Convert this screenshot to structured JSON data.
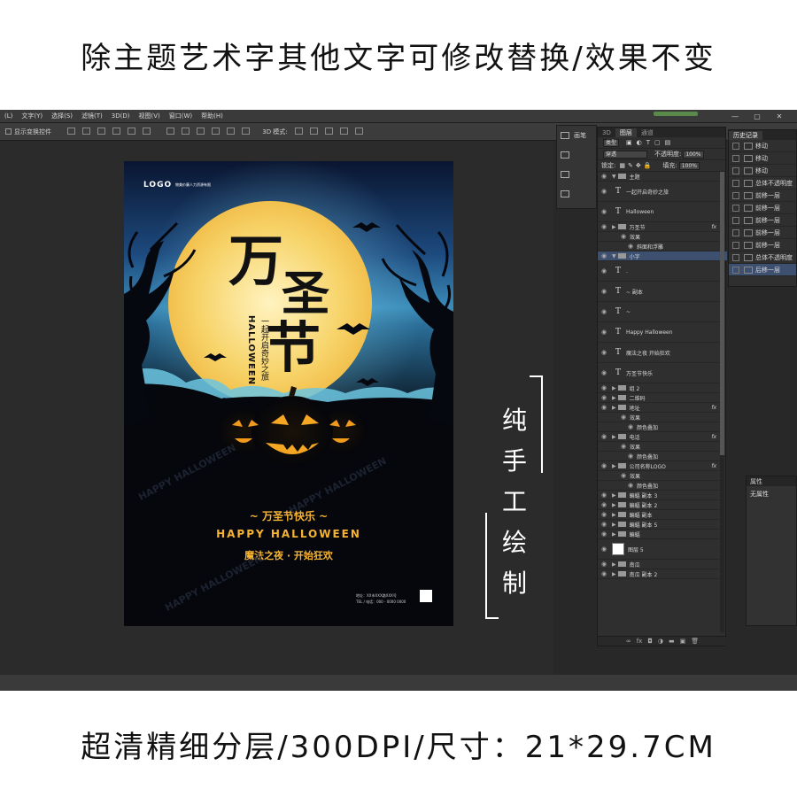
{
  "top_banner": "除主题艺术字其他文字可修改替换/效果不变",
  "bottom_banner": "超清精细分层/300DPI/尺寸：21*29.7CM",
  "side_label": [
    "纯",
    "手",
    "工",
    "绘",
    "制"
  ],
  "menu": [
    "(L)",
    "文字(Y)",
    "选择(S)",
    "滤镜(T)",
    "3D(D)",
    "视图(V)",
    "窗口(W)",
    "帮助(H)"
  ],
  "optbar": {
    "show_transform": "显示变换控件",
    "mode_3d": "3D 模式:"
  },
  "toolstrip": [
    "画笔",
    "",
    "",
    ""
  ],
  "poster": {
    "logo": "LOGO",
    "logo_sub": "物美价廉人力资源有限",
    "title_big_1": "万",
    "title_big_2": "圣",
    "title_big_3": "节",
    "title_vertical_en": "HALLOWEEN",
    "title_vertical_cn": "一起开启奇妙之旅",
    "line1": "~ 万圣节快乐 ~",
    "line2": "HAPPY HALLOWEEN",
    "line3": "魔法之夜 · 开始狂欢",
    "bg_watermark": "HAPPY HALLOWEEN",
    "addr": "地址：XX市XXX路XXX号",
    "tel": "TEL / 电话：000 - 0000 0000",
    "colors": {
      "sky_top": "#0c1a36",
      "sky_mid": "#2f73a4",
      "moon": "#f7d46a",
      "pumpkin": "#f29a1c",
      "text_gold": "#f5b331"
    }
  },
  "layers": {
    "tabs": [
      "3D",
      "图层",
      "通道"
    ],
    "filter": "类型",
    "blend": "穿透",
    "opacity_label": "不透明度:",
    "opacity": "100%",
    "lock_label": "锁定:",
    "fill_label": "填充:",
    "fill": "100%",
    "rows": [
      {
        "kind": "group",
        "name": "主题"
      },
      {
        "kind": "text",
        "name": "一起开启奇妙之旅"
      },
      {
        "kind": "text",
        "name": "Halloween"
      },
      {
        "kind": "group",
        "name": "万圣节",
        "fx": "fx"
      },
      {
        "kind": "effect",
        "name": "效果"
      },
      {
        "kind": "effect2",
        "name": "斜面和浮雕"
      },
      {
        "kind": "group-sel",
        "name": "小字"
      },
      {
        "kind": "text",
        "name": "."
      },
      {
        "kind": "text",
        "name": "~ 副本"
      },
      {
        "kind": "text",
        "name": "~"
      },
      {
        "kind": "text",
        "name": "Happy Halloween"
      },
      {
        "kind": "text",
        "name": "魔法之夜 开始狂欢"
      },
      {
        "kind": "text",
        "name": "万圣节快乐"
      },
      {
        "kind": "group",
        "name": "组 2"
      },
      {
        "kind": "group",
        "name": "二维码"
      },
      {
        "kind": "group",
        "name": "地址",
        "fx": "fx"
      },
      {
        "kind": "effect",
        "name": "效果"
      },
      {
        "kind": "effect2",
        "name": "颜色叠加"
      },
      {
        "kind": "group",
        "name": "电话",
        "fx": "fx"
      },
      {
        "kind": "effect",
        "name": "效果"
      },
      {
        "kind": "effect2",
        "name": "颜色叠加"
      },
      {
        "kind": "group",
        "name": "公司名称LOGO",
        "fx": "fx"
      },
      {
        "kind": "effect",
        "name": "效果"
      },
      {
        "kind": "effect2",
        "name": "颜色叠加"
      },
      {
        "kind": "group",
        "name": "蝙蝠 副本 3"
      },
      {
        "kind": "group",
        "name": "蝙蝠 副本 2"
      },
      {
        "kind": "group",
        "name": "蝙蝠 副本"
      },
      {
        "kind": "group",
        "name": "蝙蝠 副本 5"
      },
      {
        "kind": "group",
        "name": "蝙蝠"
      },
      {
        "kind": "image",
        "name": "图层 5"
      },
      {
        "kind": "group",
        "name": "南瓜"
      },
      {
        "kind": "group",
        "name": "南瓜 副本 2"
      }
    ],
    "footer_icons": [
      "∞",
      "fx",
      "◘",
      "◑",
      "▬",
      "▣",
      "🗑"
    ]
  },
  "history": {
    "title": "历史记录",
    "rows": [
      {
        "name": "移动",
        "icon": true
      },
      {
        "name": "移动",
        "icon": true
      },
      {
        "name": "移动",
        "icon": true
      },
      {
        "name": "总体不透明度",
        "icon": false
      },
      {
        "name": "前移一层",
        "icon": false
      },
      {
        "name": "前移一层",
        "icon": false
      },
      {
        "name": "前移一层",
        "icon": false
      },
      {
        "name": "前移一层",
        "icon": false
      },
      {
        "name": "前移一层",
        "icon": false
      },
      {
        "name": "总体不透明度",
        "icon": false
      },
      {
        "name": "后移一层",
        "icon": false,
        "selected": true
      }
    ]
  },
  "properties": {
    "title": "属性",
    "value": "无属性"
  }
}
